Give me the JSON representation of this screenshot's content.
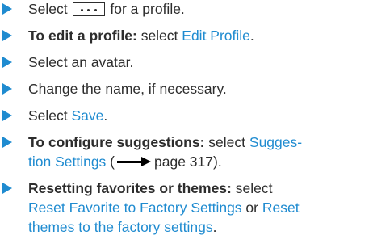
{
  "colors": {
    "accent": "#1f8bd0",
    "text": "#2d2d2d"
  },
  "icons": {
    "bullet": "triangle-arrow-icon",
    "key": "more-dots-icon",
    "reference": "long-arrow-right-icon"
  },
  "steps": [
    {
      "pre": "Select",
      "post": "for a profile."
    },
    {
      "lead": "To edit a profile:",
      "pre": " select ",
      "link": "Edit Profile",
      "post": "."
    },
    {
      "text": "Select an avatar."
    },
    {
      "text": "Change the name, if necessary."
    },
    {
      "pre": "Select ",
      "link": "Save",
      "post": "."
    },
    {
      "lead": "To configure suggestions:",
      "pre": " select ",
      "link_line1": "Sugges-",
      "link_line2": "tion Settings",
      "mid": " (",
      "ref": "page 317).",
      "post": ""
    },
    {
      "lead": "Resetting favorites or themes:",
      "pre": " select",
      "link1": "Reset Favorite to Factory Settings",
      "or": " or ",
      "link2_line1": "Reset",
      "link2_line2": "themes to the factory settings",
      "post": "."
    }
  ]
}
